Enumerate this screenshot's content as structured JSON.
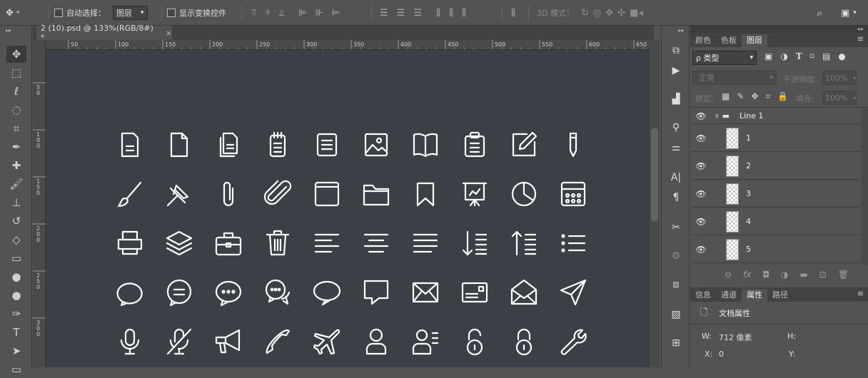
{
  "options_bar": {
    "auto_select_label": "自动选择：",
    "auto_select_value": "图层",
    "show_transform_label": "显示变换控件",
    "mode_3d_label": "3D 模式："
  },
  "document_tab": {
    "title": "2 (10).psd @ 133%(RGB/8#) *",
    "close": "×"
  },
  "ruler": {
    "h_ticks": [
      "50",
      "100",
      "150",
      "200",
      "250",
      "300",
      "350",
      "400",
      "450",
      "500",
      "550",
      "600",
      "650"
    ],
    "v_ticks": [
      "5 0",
      "1 0 0",
      "1 5 0",
      "2 0 0",
      "2 5 0",
      "3 0 0"
    ]
  },
  "icon_rows": [
    [
      "document-icon",
      "blank-file-icon",
      "copy-files-icon",
      "notepad-icon",
      "text-list-icon",
      "image-icon",
      "open-book-icon",
      "clipboard-icon",
      "edit-icon",
      "pencil-icon"
    ],
    [
      "brush-icon",
      "pin-icon",
      "paperclip-icon",
      "attachment-icon",
      "window-icon",
      "folder-icon",
      "bookmark-icon",
      "presentation-icon",
      "pie-chart-icon",
      "calculator-icon"
    ],
    [
      "printer-icon",
      "layers-icon",
      "briefcase-icon",
      "trash-icon",
      "align-left-icon",
      "align-center-icon",
      "align-justify-icon",
      "sort-down-icon",
      "sort-up-icon",
      "bullet-list-icon"
    ],
    [
      "chat-bubble-icon",
      "message-icon",
      "comment-dots-icon",
      "conversation-icon",
      "speech-icon",
      "square-chat-icon",
      "envelope-icon",
      "card-icon",
      "open-envelope-icon",
      "send-icon"
    ],
    [
      "microphone-icon",
      "mic-off-icon",
      "megaphone-icon",
      "phone-icon",
      "airplane-icon",
      "user-icon",
      "user-list-icon",
      "unlock-icon",
      "lock-icon",
      "wrench-icon"
    ]
  ],
  "right_panel": {
    "top_tabs": [
      "颜色",
      "色板",
      "图层"
    ],
    "filter_label": "ρ 类型",
    "blend_mode": "正常",
    "opacity_label": "不透明度:",
    "opacity_value": "100%",
    "lock_label": "锁定:",
    "fill_label": "填充:",
    "fill_value": "100%",
    "group_name": "Line 1",
    "layers": [
      "1",
      "2",
      "3",
      "4",
      "5"
    ],
    "bottom_tabs": [
      "信息",
      "通道",
      "属性",
      "路径"
    ],
    "doc_props_label": "文档属性",
    "w_label": "W:",
    "w_value": "712 像素",
    "h_label": "H:",
    "x_label": "X:",
    "x_value": "0",
    "y_label": "Y:"
  },
  "colors": {
    "icon_stroke": "#ffffff",
    "canvas": "#3a4045",
    "ui": "#535353"
  }
}
